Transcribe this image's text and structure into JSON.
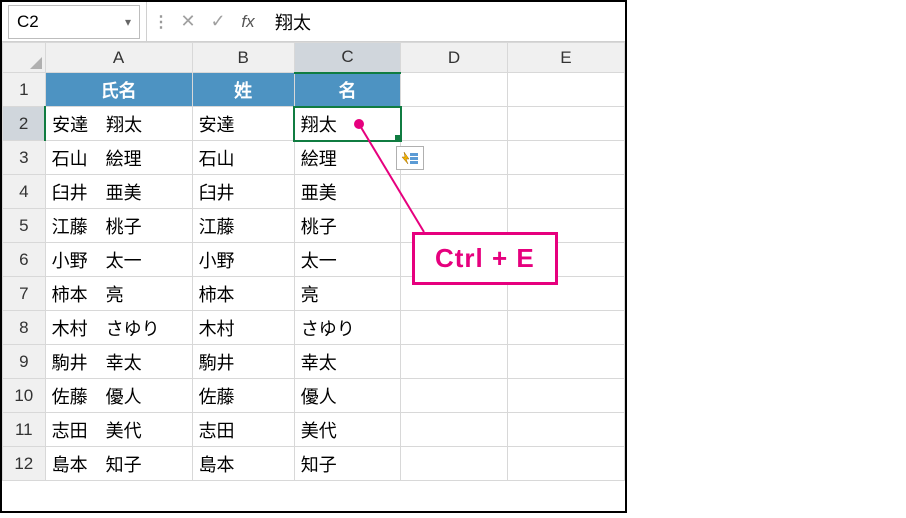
{
  "namebox": {
    "cellref": "C2"
  },
  "formula_bar": {
    "value": "翔太"
  },
  "col_headers": [
    "A",
    "B",
    "C",
    "D",
    "E"
  ],
  "row_numbers": [
    "1",
    "2",
    "3",
    "4",
    "5",
    "6",
    "7",
    "8",
    "9",
    "10",
    "11",
    "12"
  ],
  "header_row": {
    "A": "氏名",
    "B": "姓",
    "C": "名"
  },
  "rows": [
    {
      "A": "安達　翔太",
      "B": "安達",
      "C": "翔太"
    },
    {
      "A": "石山　絵理",
      "B": "石山",
      "C": "絵理"
    },
    {
      "A": "臼井　亜美",
      "B": "臼井",
      "C": "亜美"
    },
    {
      "A": "江藤　桃子",
      "B": "江藤",
      "C": "桃子"
    },
    {
      "A": "小野　太一",
      "B": "小野",
      "C": "太一"
    },
    {
      "A": "柿本　亮",
      "B": "柿本",
      "C": "亮"
    },
    {
      "A": "木村　さゆり",
      "B": "木村",
      "C": "さゆり"
    },
    {
      "A": "駒井　幸太",
      "B": "駒井",
      "C": "幸太"
    },
    {
      "A": "佐藤　優人",
      "B": "佐藤",
      "C": "優人"
    },
    {
      "A": "志田　美代",
      "B": "志田",
      "C": "美代"
    },
    {
      "A": "島本　知子",
      "B": "島本",
      "C": "知子"
    }
  ],
  "callout": {
    "text": "Ctrl + E"
  },
  "active_cell": "C2",
  "selected_col": "C",
  "selected_row": "2"
}
